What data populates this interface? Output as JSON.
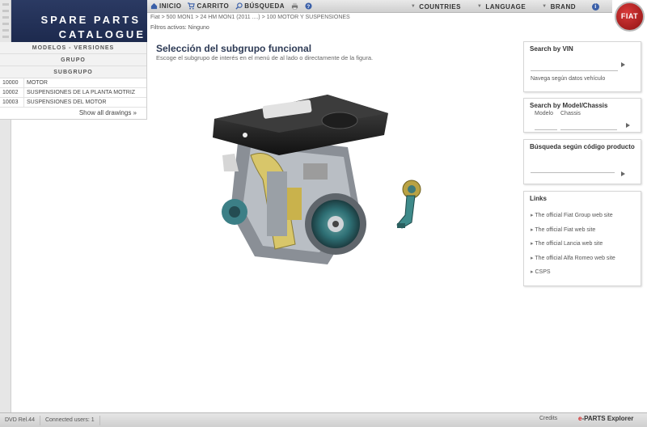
{
  "logo": {
    "line1": "SPARE PARTS",
    "line2": "CATALOGUE"
  },
  "toolbar": {
    "inicio": "INICIO",
    "carrito": "CARRITO",
    "busqueda": "BÚSQUEDA",
    "countries": "COUNTRIES",
    "language": "LANGUAGE",
    "brand": "BRAND",
    "info": "i"
  },
  "brand_badge": "FIAT",
  "breadcrumb": "Fiat > 500 MON1 > 24 HM MON1 (2011 ....) > 100 MOTOR Y SUSPENSIONES",
  "filters": "Filtros activos: Ninguno",
  "menu": {
    "headers": [
      "MODELOS - VERSIONES",
      "GRUPO",
      "SUBGRUPO"
    ],
    "rows": [
      {
        "code": "10000",
        "desc": "MOTOR"
      },
      {
        "code": "10002",
        "desc": "SUSPENSIONES DE LA PLANTA MOTRIZ"
      },
      {
        "code": "10003",
        "desc": "SUSPENSIONES DEL MOTOR"
      }
    ],
    "show_all": "Show all drawings »"
  },
  "main": {
    "title": "Selección del subgrupo funcional",
    "subtitle": "Escoge el subgrupo de interés en el menú de al lado o directamente de la figura."
  },
  "panels": {
    "vin": {
      "title": "Search by VIN",
      "link": "Navega según datos vehículo"
    },
    "model": {
      "title": "Search by Model/Chassis",
      "model_label": "Modelo",
      "chassis_label": "Chassis"
    },
    "code": {
      "title": "Búsqueda según código producto"
    },
    "links": {
      "title": "Links",
      "items": [
        "The official Fiat Group web site",
        "The official Fiat web site",
        "The official Lancia web site",
        "The official Alfa Romeo web site",
        "CSPS"
      ]
    }
  },
  "status": {
    "version": "DVD Rel.44",
    "users": "Connected users: 1",
    "credits": "Credits",
    "brand_e": "e",
    "brand_parts": "-PARTS Explorer"
  },
  "colors": {
    "header_blue": "#1d2a4e",
    "fiat_red": "#a31919",
    "panel_border": "#d6d6d6"
  }
}
